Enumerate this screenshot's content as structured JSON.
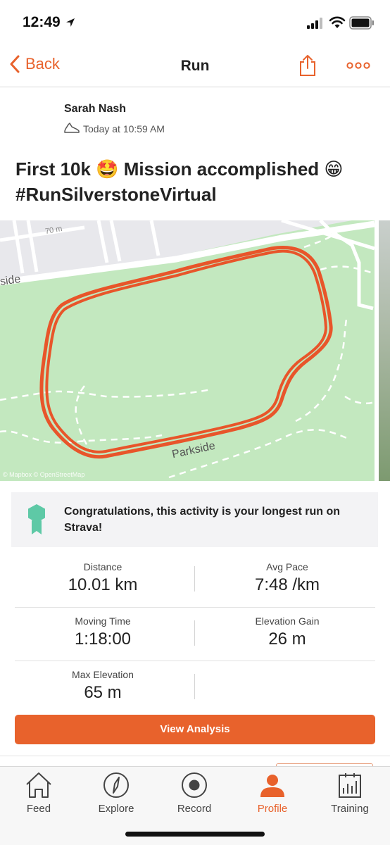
{
  "status_bar": {
    "time": "12:49"
  },
  "nav": {
    "back_label": "Back",
    "title": "Run"
  },
  "activity": {
    "athlete": "Sarah Nash",
    "date": "Today at 10:59 AM",
    "title": "First 10k 🤩 Mission accomplished 😁 #RunSilverstoneVirtual"
  },
  "map": {
    "street_label": "Parkside",
    "street_label_2": "side",
    "contour_label": "70 m",
    "attribution": "© Mapbox © OpenStreetMap"
  },
  "achievement": {
    "text": "Congratulations, this activity is your longest run on Strava!"
  },
  "stats": [
    {
      "left_label": "Distance",
      "left_value": "10.01 km",
      "right_label": "Avg Pace",
      "right_value": "7:48 /km"
    },
    {
      "left_label": "Moving Time",
      "left_value": "1:18:00",
      "right_label": "Elevation Gain",
      "right_value": "26 m"
    },
    {
      "left_label": "Max Elevation",
      "left_value": "65 m",
      "right_label": "",
      "right_value": ""
    }
  ],
  "analysis_button": "View Analysis",
  "tabs": [
    {
      "label": "Feed",
      "icon": "home-icon"
    },
    {
      "label": "Explore",
      "icon": "compass-icon"
    },
    {
      "label": "Record",
      "icon": "record-icon"
    },
    {
      "label": "Profile",
      "icon": "profile-icon"
    },
    {
      "label": "Training",
      "icon": "training-icon"
    }
  ],
  "colors": {
    "accent": "#e8622c",
    "route": "#e8552a",
    "park": "#c3e8bf",
    "medal": "#5ec9a6"
  }
}
